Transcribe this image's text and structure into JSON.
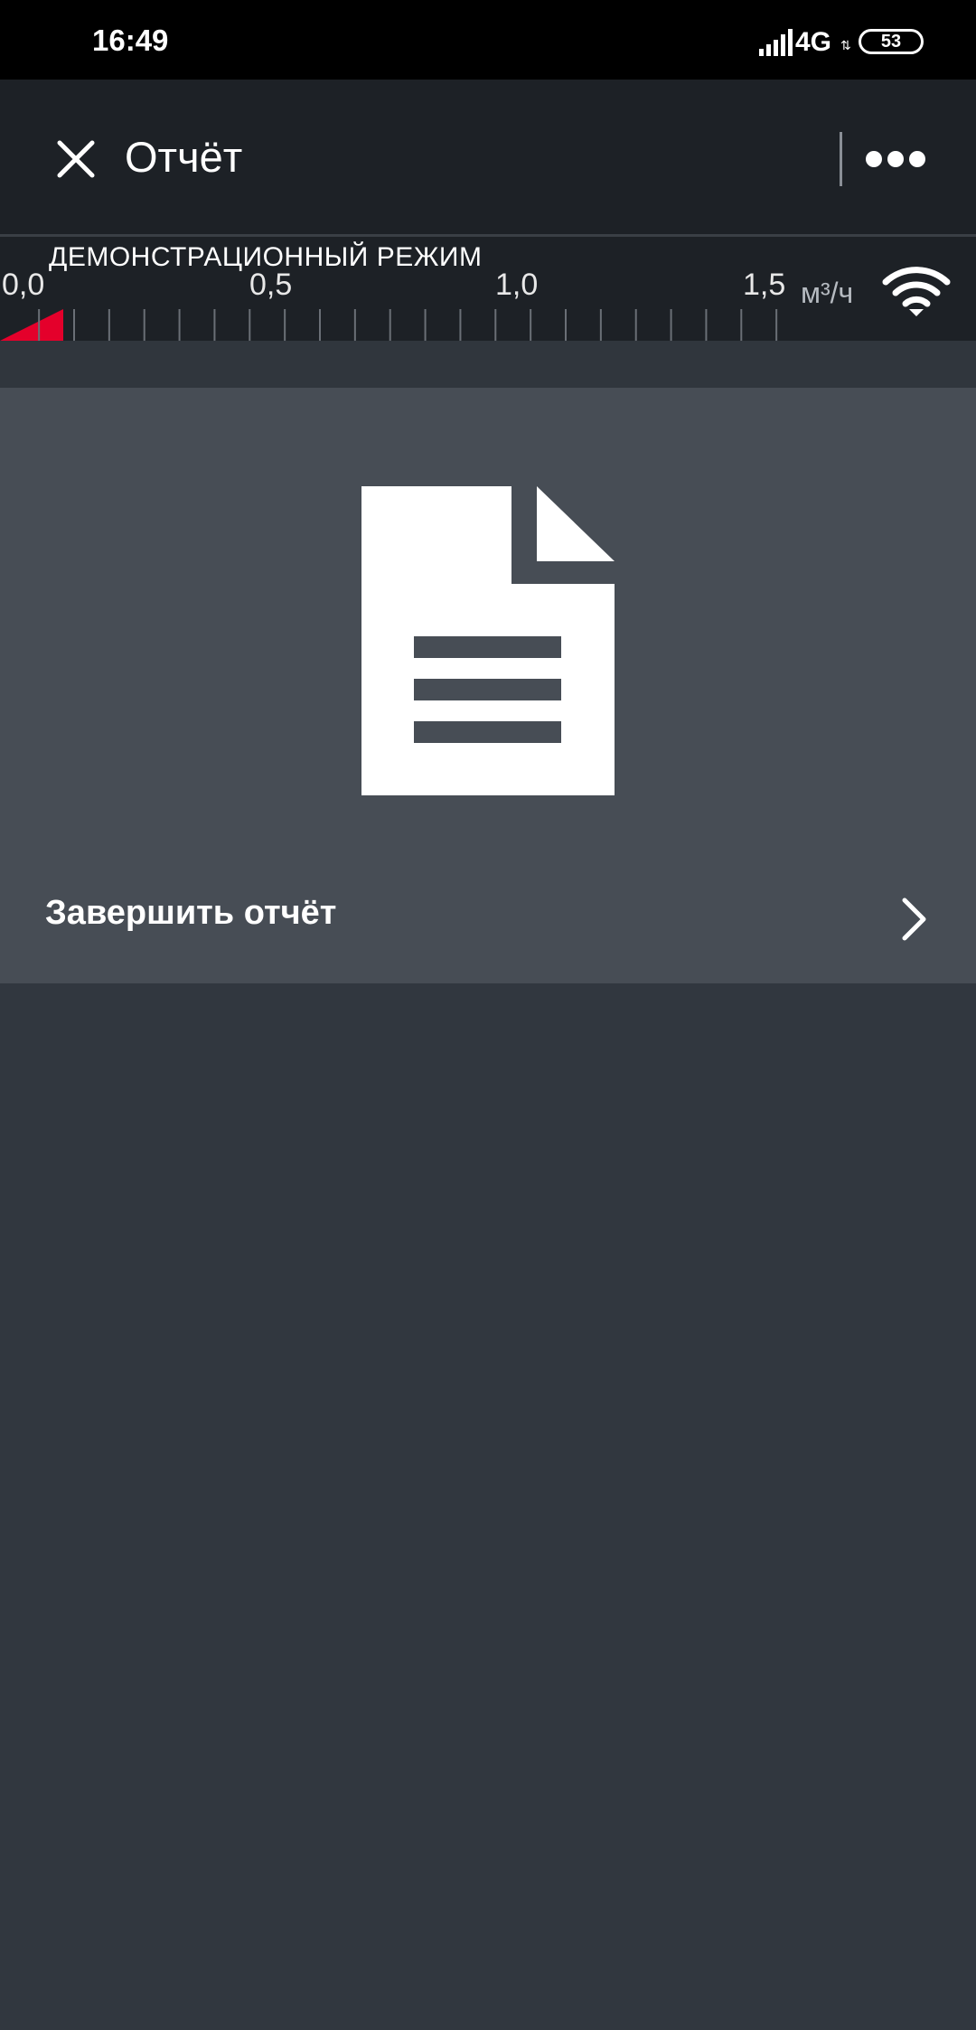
{
  "status_bar": {
    "time": "16:49",
    "network": "4G",
    "battery": "53",
    "icons": [
      "signal-icon",
      "network-arrows-icon",
      "battery-icon"
    ]
  },
  "app_bar": {
    "title": "Отчёт",
    "close_icon": "close-icon",
    "more_icon": "more-icon"
  },
  "scale": {
    "mode_label": "ДЕМОНСТРАЦИОННЫЙ РЕЖИМ",
    "ticks": [
      "0,0",
      "0,5",
      "1,0",
      "1,5"
    ],
    "unit": "м³/ч",
    "current_value": 0.125,
    "max_value": 1.8,
    "indicator_color": "#e4002b",
    "wifi_icon": "wifi-icon"
  },
  "report": {
    "icon": "document-icon",
    "finish_label": "Завершить отчёт",
    "chevron_icon": "chevron-right-icon"
  }
}
